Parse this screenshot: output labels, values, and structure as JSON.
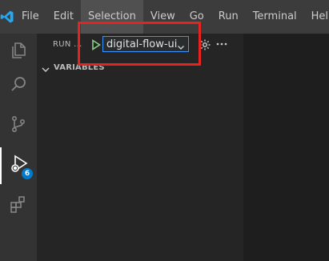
{
  "menu": {
    "items": [
      "File",
      "Edit",
      "Selection",
      "View",
      "Go",
      "Run",
      "Terminal",
      "Help"
    ],
    "selected_item": "Selection"
  },
  "activity_bar": {
    "items": [
      {
        "icon": "files-icon"
      },
      {
        "icon": "search-icon"
      },
      {
        "icon": "source-control-icon"
      },
      {
        "icon": "run-debug-icon",
        "badge": "6"
      },
      {
        "icon": "extensions-icon"
      }
    ]
  },
  "run_panel": {
    "title": "RUN ...",
    "configuration": "digital-flow-ui",
    "variables_section": "VARIABLES"
  },
  "colors": {
    "accent": "#007acc",
    "focus_border": "#3794ff",
    "annotation": "#e8231e",
    "play": "#89d185"
  }
}
